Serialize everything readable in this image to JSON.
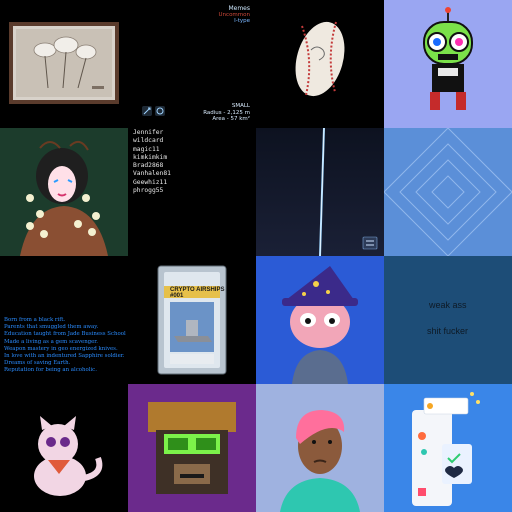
{
  "asteroid": {
    "title": "Memes",
    "rarity": "Uncommon",
    "type": "I-type",
    "size": "SMALL",
    "radius": "Radius - 2,125 m",
    "area": "Area - 57 km²",
    "colors": {
      "rarity": "#d04a3a",
      "type": "#7ab6ff"
    }
  },
  "names": {
    "items": [
      "Jennifer",
      "wildcard",
      "magic11",
      "kimkimkim",
      "Brad2868",
      "Vanhalen81",
      "Geewhiz11",
      "phrogg55"
    ]
  },
  "story": {
    "lines": [
      "Born from a black rift.",
      "Parents that smuggled them away.",
      "Education taught from Jade Business School",
      "Made a living as a gem scavenger.",
      "Weapon mastery in geo energized knives.",
      "In love with an indentured Sapphire soldier.",
      "Dreams of saving Earth.",
      "Reputation for being an alcoholic."
    ]
  },
  "text_art": {
    "line1": "weak ass",
    "line2": "shit fucker"
  },
  "crypto_card": {
    "brand": "CRYPTO AIRSHIPS",
    "number": "#001"
  }
}
